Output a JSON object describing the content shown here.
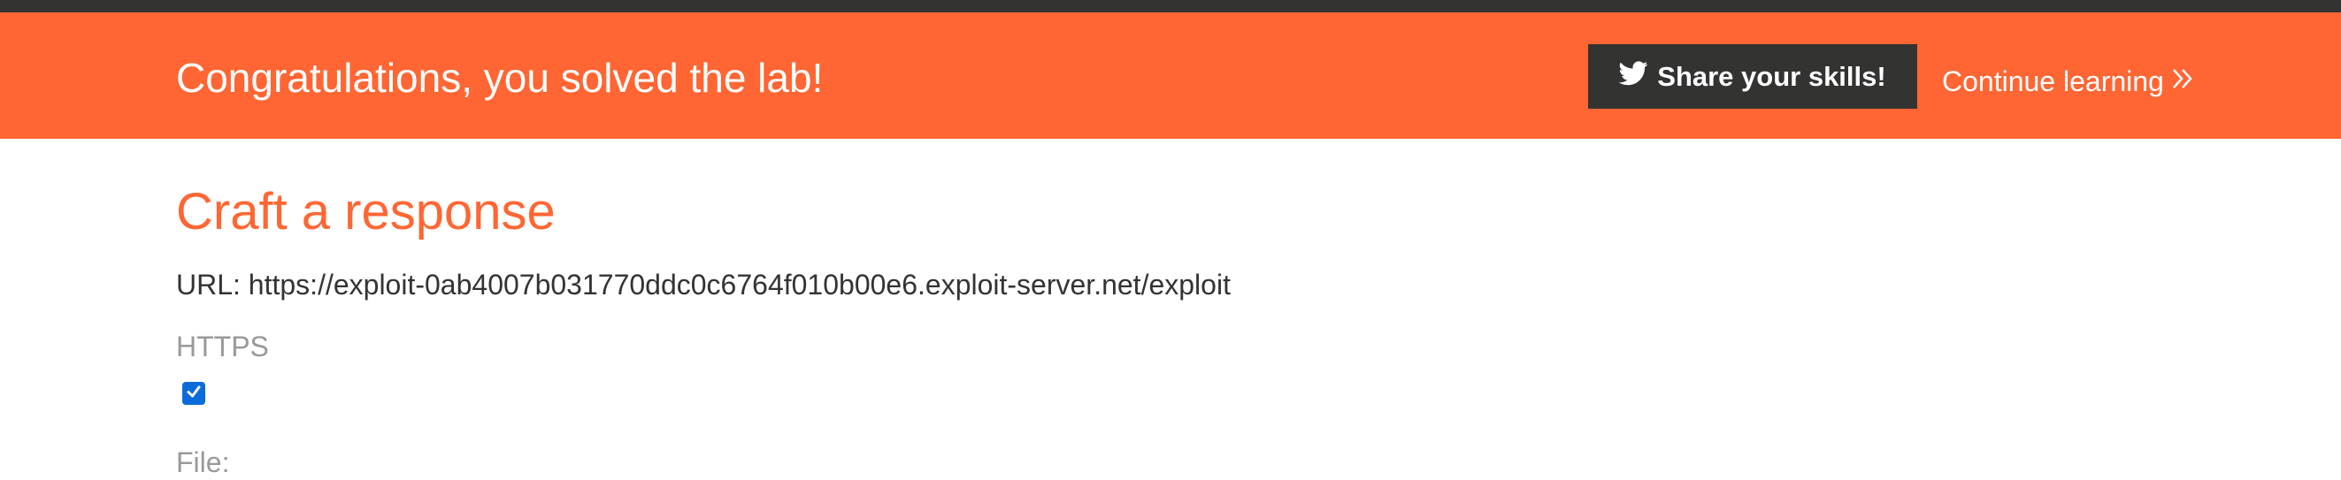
{
  "banner": {
    "title": "Congratulations, you solved the lab!",
    "share_label": "Share your skills!",
    "share_icon": "twitter-icon",
    "continue_label": "Continue learning",
    "continue_icon": "double-chevron-right-icon",
    "background_color": "#ff6633",
    "button_color": "#333332"
  },
  "main": {
    "title": "Craft a response",
    "url_line": "URL: https://exploit-0ab4007b031770ddc0c6764f010b00e6.exploit-server.net/exploit",
    "https_label": "HTTPS",
    "https_checked": true,
    "file_label": "File:"
  },
  "colors": {
    "accent": "#ff6633",
    "text": "#333332",
    "muted": "#999999",
    "checkbox": "#0b6bdb"
  }
}
